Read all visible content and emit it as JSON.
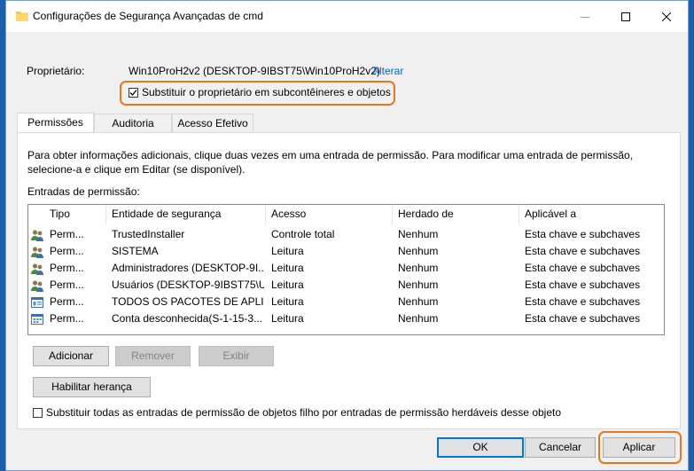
{
  "window": {
    "title": "Configurações de Segurança Avançadas de cmd"
  },
  "owner": {
    "label": "Proprietário:",
    "value": "Win10ProH2v2 (DESKTOP-9IBST75\\Win10ProH2v2)",
    "change_link": "Alterar",
    "replace_checkbox_label": "Substituir o proprietário em subcontêineres e objetos",
    "replace_checked": true
  },
  "tabs": [
    {
      "label": "Permissões",
      "active": true
    },
    {
      "label": "Auditoria",
      "active": false
    },
    {
      "label": "Acesso Efetivo",
      "active": false
    }
  ],
  "permissions": {
    "info_text": "Para obter informações adicionais, clique duas vezes em uma entrada de permissão. Para modificar uma entrada de permissão, selecione-a e clique em Editar (se disponível).",
    "entries_label": "Entradas de permissão:",
    "columns": [
      "Tipo",
      "Entidade de segurança",
      "Acesso",
      "Herdado de",
      "Aplicável a"
    ],
    "rows": [
      {
        "icon": "users-icon",
        "type": "Perm...",
        "principal": "TrustedInstaller",
        "access": "Controle total",
        "inherited": "Nenhum",
        "applies": "Esta chave e subchaves"
      },
      {
        "icon": "users-icon",
        "type": "Perm...",
        "principal": "SISTEMA",
        "access": "Leitura",
        "inherited": "Nenhum",
        "applies": "Esta chave e subchaves"
      },
      {
        "icon": "users-icon",
        "type": "Perm...",
        "principal": "Administradores (DESKTOP-9I...",
        "access": "Leitura",
        "inherited": "Nenhum",
        "applies": "Esta chave e subchaves"
      },
      {
        "icon": "users-icon",
        "type": "Perm...",
        "principal": "Usuários (DESKTOP-9IBST75\\U...",
        "access": "Leitura",
        "inherited": "Nenhum",
        "applies": "Esta chave e subchaves"
      },
      {
        "icon": "app-package-icon",
        "type": "Perm...",
        "principal": "TODOS OS PACOTES DE APLIC...",
        "access": "Leitura",
        "inherited": "Nenhum",
        "applies": "Esta chave e subchaves"
      },
      {
        "icon": "unknown-account-icon",
        "type": "Perm...",
        "principal": "Conta desconhecida(S-1-15-3...",
        "access": "Leitura",
        "inherited": "Nenhum",
        "applies": "Esta chave e subchaves"
      }
    ],
    "add_button": "Adicionar",
    "remove_button": "Remover",
    "view_button": "Exibir",
    "enable_inheritance_button": "Habilitar herança",
    "replace_child_label": "Substituir todas as entradas de permissão de objetos filho por entradas de permissão herdáveis desse objeto",
    "replace_child_checked": false
  },
  "footer": {
    "ok": "OK",
    "cancel": "Cancelar",
    "apply": "Aplicar"
  },
  "colors": {
    "highlight": "#e8761e",
    "link": "#0066cc",
    "accent": "#0078d7"
  }
}
